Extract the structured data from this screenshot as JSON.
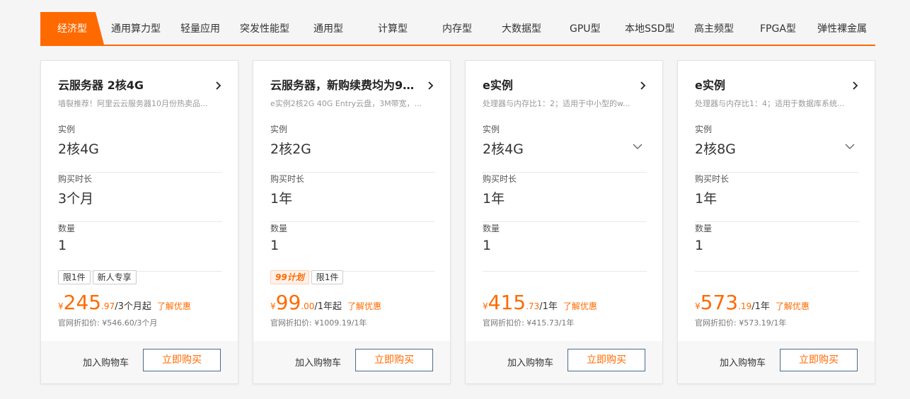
{
  "accent_color": "#ff6a00",
  "tabs": [
    {
      "label": "经济型",
      "active": true
    },
    {
      "label": "通用算力型"
    },
    {
      "label": "轻量应用"
    },
    {
      "label": "突发性能型"
    },
    {
      "label": "通用型"
    },
    {
      "label": "计算型"
    },
    {
      "label": "内存型"
    },
    {
      "label": "大数据型"
    },
    {
      "label": "GPU型"
    },
    {
      "label": "本地SSD型"
    },
    {
      "label": "高主频型"
    },
    {
      "label": "FPGA型"
    },
    {
      "label": "弹性裸金属"
    }
  ],
  "field_labels": {
    "instance": "实例",
    "duration": "购买时长",
    "quantity": "数量"
  },
  "cards": [
    {
      "title": "云服务器 2核4G",
      "desc": "墙裂推荐！阿里云云服务器10月份热卖品...",
      "instance": "2核4G",
      "instance_dropdown": false,
      "duration": "3个月",
      "quantity": "1",
      "tags": [
        {
          "label": "限1件",
          "promo": false
        },
        {
          "label": "新人专享",
          "promo": false
        }
      ],
      "price": {
        "currency": "¥",
        "int": "245",
        "dec": ".97",
        "unit": "/3个月起"
      },
      "link": "了解优惠",
      "official": "官网折扣价: ¥546.60/3个月",
      "cart": "加入购物车",
      "buy": "立即购买"
    },
    {
      "title": "云服务器，新购续费均为9...",
      "desc": "e实例2核2G 40G Entry云盘，3M带宽，...",
      "instance": "2核2G",
      "instance_dropdown": false,
      "duration": "1年",
      "quantity": "1",
      "tags": [
        {
          "label": "99计划",
          "promo": true
        },
        {
          "label": "限1件",
          "promo": false
        }
      ],
      "price": {
        "currency": "¥",
        "int": "99",
        "dec": ".00",
        "unit": "/1年起"
      },
      "link": "了解优惠",
      "official": "官网折扣价: ¥1009.19/1年",
      "cart": "加入购物车",
      "buy": "立即购买"
    },
    {
      "title": "e实例",
      "desc": "处理器与内存比1：2；适用于中小型的w...",
      "instance": "2核4G",
      "instance_dropdown": true,
      "duration": "1年",
      "quantity": "1",
      "tags": [],
      "price": {
        "currency": "¥",
        "int": "415",
        "dec": ".73",
        "unit": "/1年"
      },
      "link": "了解优惠",
      "official": "官网折扣价: ¥415.73/1年",
      "cart": "加入购物车",
      "buy": "立即购买"
    },
    {
      "title": "e实例",
      "desc": "处理器与内存比1：4；适用于数据库系统...",
      "instance": "2核8G",
      "instance_dropdown": true,
      "duration": "1年",
      "quantity": "1",
      "tags": [],
      "price": {
        "currency": "¥",
        "int": "573",
        "dec": ".19",
        "unit": "/1年"
      },
      "link": "了解优惠",
      "official": "官网折扣价: ¥573.19/1年",
      "cart": "加入购物车",
      "buy": "立即购买"
    }
  ]
}
